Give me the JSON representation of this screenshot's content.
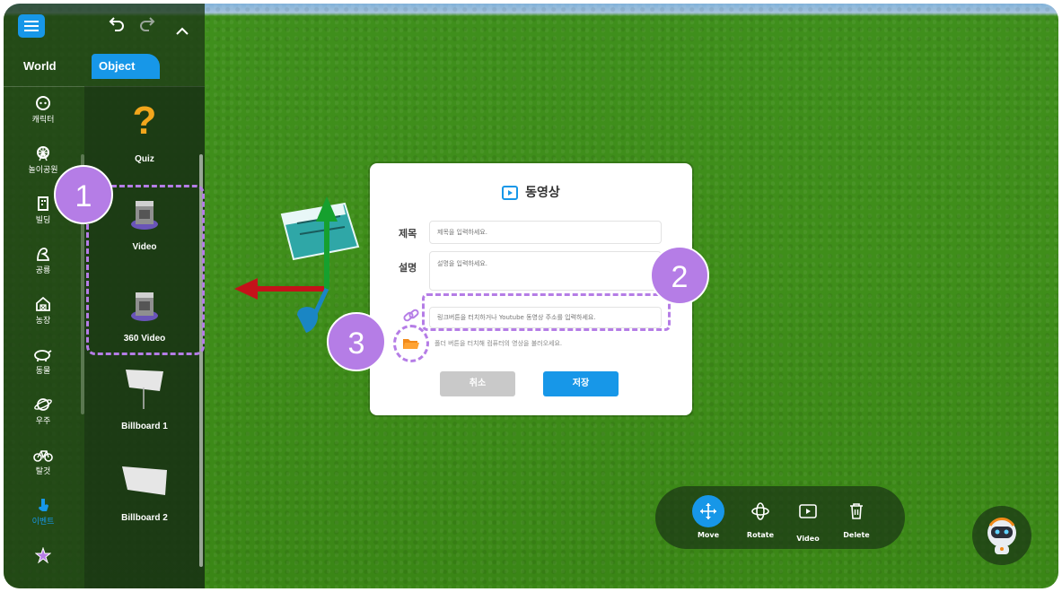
{
  "sidebar": {
    "tabs": {
      "world": "World",
      "object": "Object"
    },
    "categories": [
      {
        "label": "캐릭터",
        "icon": "character-icon"
      },
      {
        "label": "놀이공원",
        "icon": "ferris-wheel-icon"
      },
      {
        "label": "빌딩",
        "icon": "building-icon"
      },
      {
        "label": "공룡",
        "icon": "dinosaur-icon"
      },
      {
        "label": "농장",
        "icon": "farm-icon"
      },
      {
        "label": "동물",
        "icon": "animal-icon"
      },
      {
        "label": "우주",
        "icon": "planet-icon"
      },
      {
        "label": "탈것",
        "icon": "bicycle-icon"
      },
      {
        "label": "이벤트",
        "icon": "event-icon"
      },
      {
        "label": "",
        "icon": "star-icon"
      }
    ],
    "items": [
      {
        "label": "Quiz",
        "icon": "question-mark-icon"
      },
      {
        "label": "Video",
        "icon": "video-object-icon"
      },
      {
        "label": "360 Video",
        "icon": "video-360-object-icon"
      },
      {
        "label": "Billboard 1",
        "icon": "billboard-icon"
      },
      {
        "label": "Billboard 2",
        "icon": "billboard-icon"
      }
    ]
  },
  "callouts": {
    "one": "1",
    "two": "2",
    "three": "3"
  },
  "dialog": {
    "title": "동영상",
    "title_label": "제목",
    "title_placeholder": "제목을 입력하세요.",
    "desc_label": "설명",
    "desc_placeholder": "설명을 입력하세요.",
    "link_placeholder": "링크버튼을 터치하거나 Youtube 동영상 주소를 입력하세요.",
    "folder_hint": "폴더 버튼을 터치해 컴퓨터의 영상을 불러오세요.",
    "cancel": "취소",
    "save": "저장"
  },
  "toolbar": {
    "move": "Move",
    "rotate": "Rotate",
    "video": "Video",
    "delete": "Delete"
  },
  "colors": {
    "accent": "#1797e8",
    "callout": "#b57de6",
    "grass": "#3f8e1a"
  }
}
